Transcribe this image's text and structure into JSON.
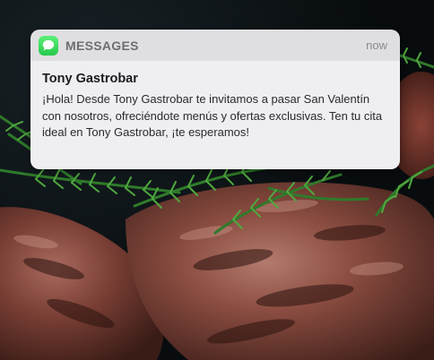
{
  "notification": {
    "app_name": "MESSAGES",
    "time": "now",
    "app_icon": "message-bubble-icon",
    "sender": "Tony Gastrobar",
    "message": "¡Hola! Desde Tony Gastrobar te invitamos a pasar San Valentín con nosotros, ofreciéndote menús y ofertas exclusivas. Ten tu cita ideal en Tony Gastrobar, ¡te esperamos!"
  },
  "colors": {
    "icon_green": "#34c759",
    "header_bg": "#dfdfe1",
    "body_bg": "#efeff1"
  }
}
